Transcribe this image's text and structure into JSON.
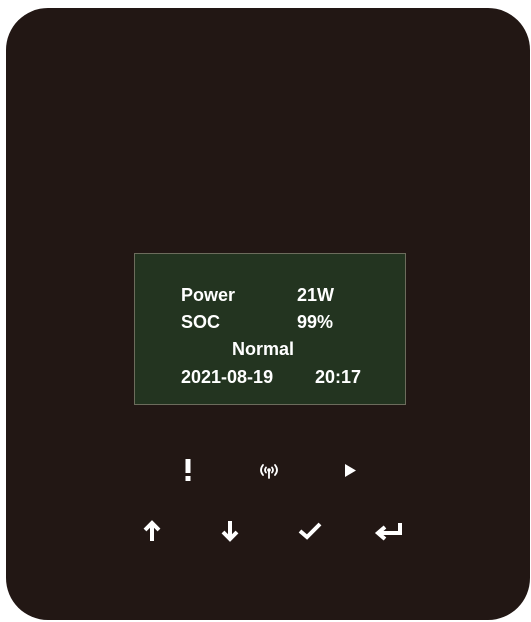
{
  "display": {
    "power_label": "Power",
    "power_value": "21W",
    "soc_label": "SOC",
    "soc_value": "99%",
    "status": "Normal",
    "date": "2021-08-19",
    "time": "20:17"
  },
  "indicators": {
    "alarm_icon": "exclamation-icon",
    "wireless_icon": "wireless-signal-icon",
    "run_icon": "play-triangle-icon"
  },
  "buttons": {
    "up": "arrow-up-icon",
    "down": "arrow-down-icon",
    "confirm": "checkmark-icon",
    "enter": "enter-return-icon"
  },
  "colors": {
    "device_body": "#221714",
    "lcd_background": "#233420",
    "text": "#ffffff"
  }
}
